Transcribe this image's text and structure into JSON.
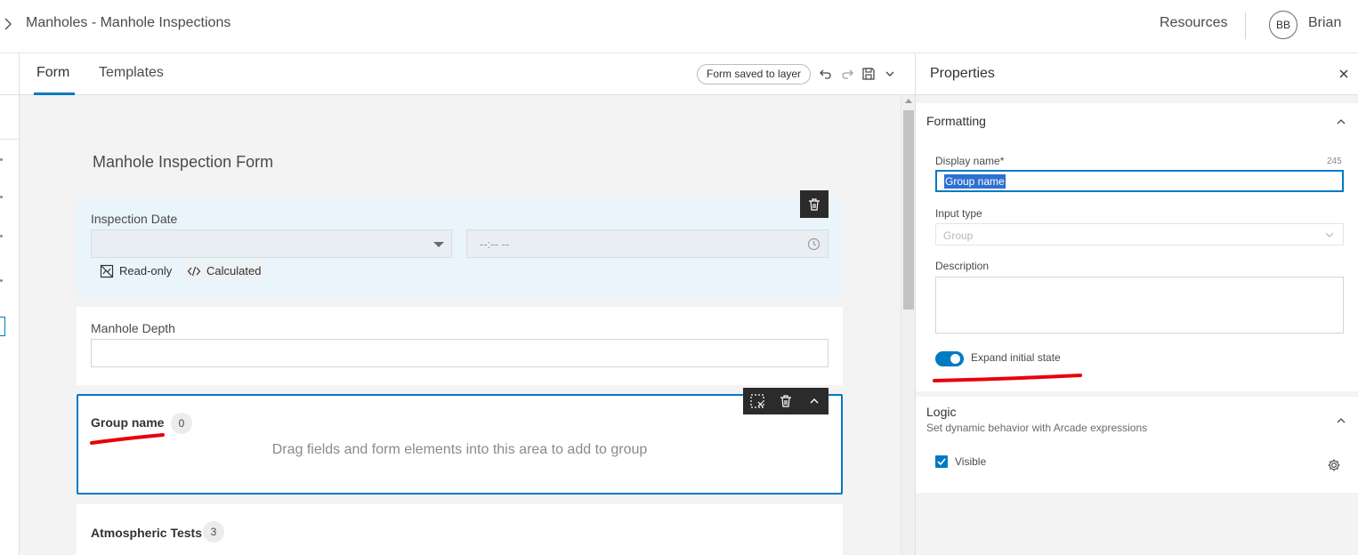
{
  "header": {
    "title": "Manholes - Manhole Inspections",
    "resources_label": "Resources",
    "avatar_initials": "BB",
    "user_name": "Brian"
  },
  "tabs": {
    "form": "Form",
    "templates": "Templates",
    "saved_status": "Form saved to layer"
  },
  "form": {
    "title": "Manhole Inspection Form",
    "inspection_date": {
      "label": "Inspection Date",
      "time_placeholder": "--:-- --",
      "readonly_label": "Read-only",
      "calculated_label": "Calculated"
    },
    "manhole_depth": {
      "label": "Manhole Depth"
    },
    "group": {
      "name": "Group name",
      "count": "0",
      "hint": "Drag fields and form elements into this area to add to group"
    },
    "atmospheric": {
      "name": "Atmospheric Tests",
      "count": "3"
    }
  },
  "properties": {
    "title": "Properties",
    "formatting": {
      "title": "Formatting",
      "display_name_label": "Display name*",
      "display_name_count": "245",
      "display_name_value": "Group name",
      "input_type_label": "Input type",
      "input_type_value": "Group",
      "description_label": "Description",
      "expand_label": "Expand initial state",
      "expand_on": true
    },
    "logic": {
      "title": "Logic",
      "subtitle": "Set dynamic behavior with Arcade expressions",
      "visible_label": "Visible",
      "visible_checked": true
    }
  },
  "colors": {
    "accent": "#007ac2",
    "annotation": "#e8000b"
  }
}
